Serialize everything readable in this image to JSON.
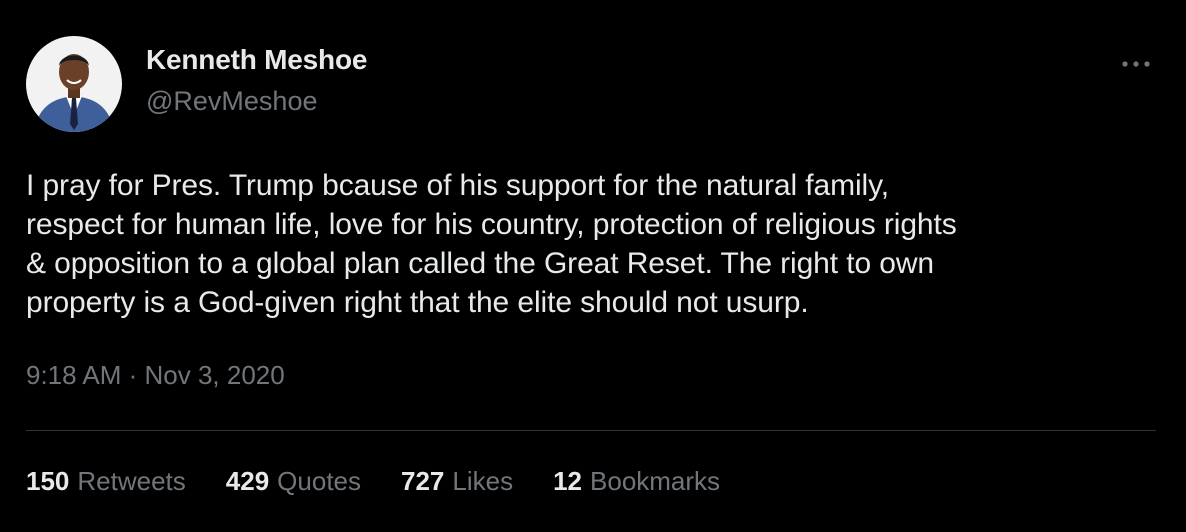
{
  "author": {
    "name": "Kenneth Meshoe",
    "handle": "@RevMeshoe",
    "avatar_icon": "profile-photo"
  },
  "tweet": {
    "text": "I pray for Pres. Trump bcause of his support for the natural family,\nrespect for human life, love for his country, protection of religious rights\n& opposition to a global plan called the Great Reset. The right to own\nproperty is a God-given right that the elite should not usurp.",
    "timestamp": "9:18 AM · Nov 3, 2020"
  },
  "stats": [
    {
      "count": "150",
      "label": "Retweets"
    },
    {
      "count": "429",
      "label": "Quotes"
    },
    {
      "count": "727",
      "label": "Likes"
    },
    {
      "count": "12",
      "label": "Bookmarks"
    }
  ],
  "more_icon": "more-horizontal-icon",
  "colors": {
    "background": "#000000",
    "primary_text": "#e7e9ea",
    "secondary_text": "#71767b",
    "divider": "#2f3336"
  }
}
